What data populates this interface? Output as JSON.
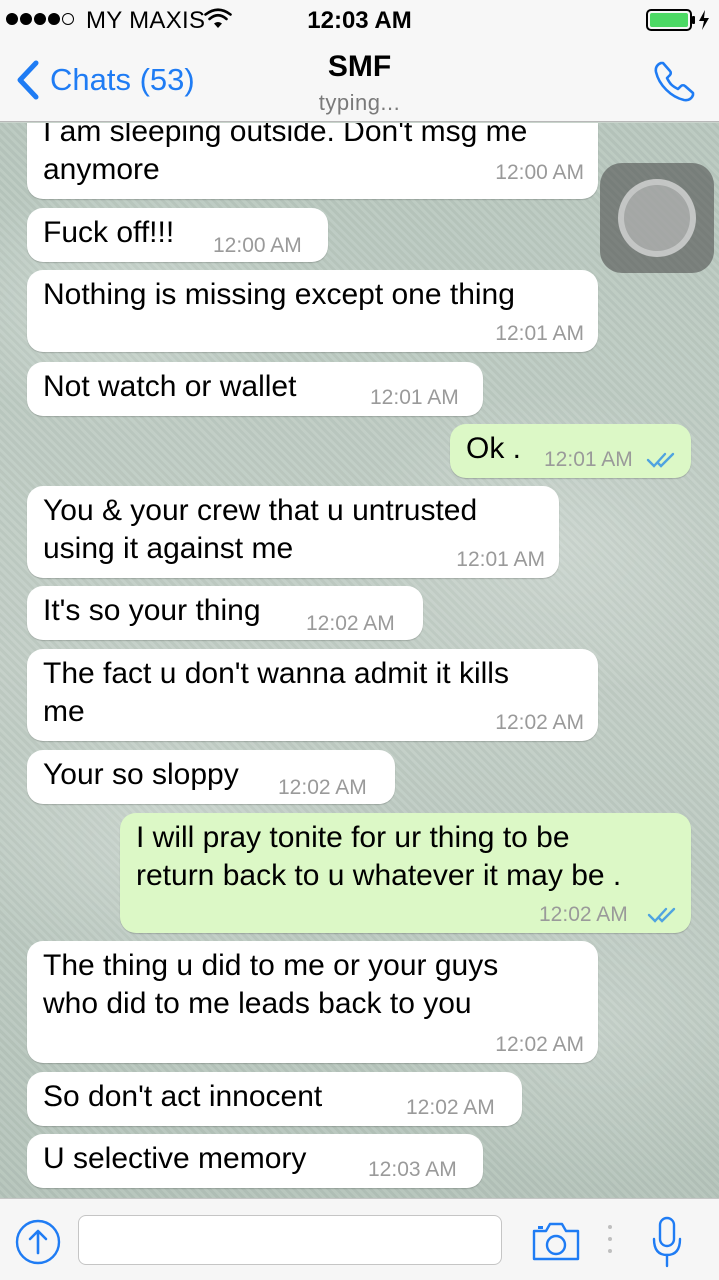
{
  "status_bar": {
    "carrier": "MY MAXIS",
    "time": "12:03 AM",
    "signal_icon": "signal-dots-icon",
    "wifi_icon": "wifi-icon",
    "battery_icon": "battery-charging-icon"
  },
  "nav": {
    "back_label": "Chats (53)",
    "title": "SMF",
    "subtitle": "typing...",
    "back_icon": "chevron-left-icon",
    "call_icon": "phone-icon"
  },
  "messages": [
    {
      "direction": "in",
      "text": "I am sleeping outside. Don't msg me\nanymore",
      "time": "12:00 AM"
    },
    {
      "direction": "in",
      "text": "Fuck off!!!",
      "time": "12:00 AM"
    },
    {
      "direction": "in",
      "text": "Nothing is missing except one thing",
      "time": "12:01 AM"
    },
    {
      "direction": "in",
      "text": "Not watch or wallet",
      "time": "12:01 AM"
    },
    {
      "direction": "out",
      "text": "Ok .",
      "time": "12:01 AM",
      "status": "read"
    },
    {
      "direction": "in",
      "text": "You & your crew that u untrusted\nusing it against me",
      "time": "12:01 AM"
    },
    {
      "direction": "in",
      "text": "It's so your thing",
      "time": "12:02 AM"
    },
    {
      "direction": "in",
      "text": "The fact u don't wanna admit it kills\nme",
      "time": "12:02 AM"
    },
    {
      "direction": "in",
      "text": "Your so sloppy",
      "time": "12:02 AM"
    },
    {
      "direction": "out",
      "text": "I will pray tonite for ur thing to be\nreturn back to u whatever it may be .",
      "time": "12:02 AM",
      "status": "read"
    },
    {
      "direction": "in",
      "text": "The thing u did to me or your guys\nwho did to me leads back to you",
      "time": "12:02 AM"
    },
    {
      "direction": "in",
      "text": "So don't act innocent",
      "time": "12:02 AM"
    },
    {
      "direction": "in",
      "text": "U selective memory",
      "time": "12:03 AM"
    }
  ],
  "input_bar": {
    "upload_icon": "upload-arrow-icon",
    "input_value": "",
    "camera_icon": "camera-icon",
    "mic_icon": "microphone-icon"
  },
  "colors": {
    "accent": "#1f7cf4",
    "incoming_bubble": "#ffffff",
    "outgoing_bubble": "#dcf8c6",
    "read_ticks": "#4fa3e0",
    "timestamp": "#9a9a9a"
  }
}
